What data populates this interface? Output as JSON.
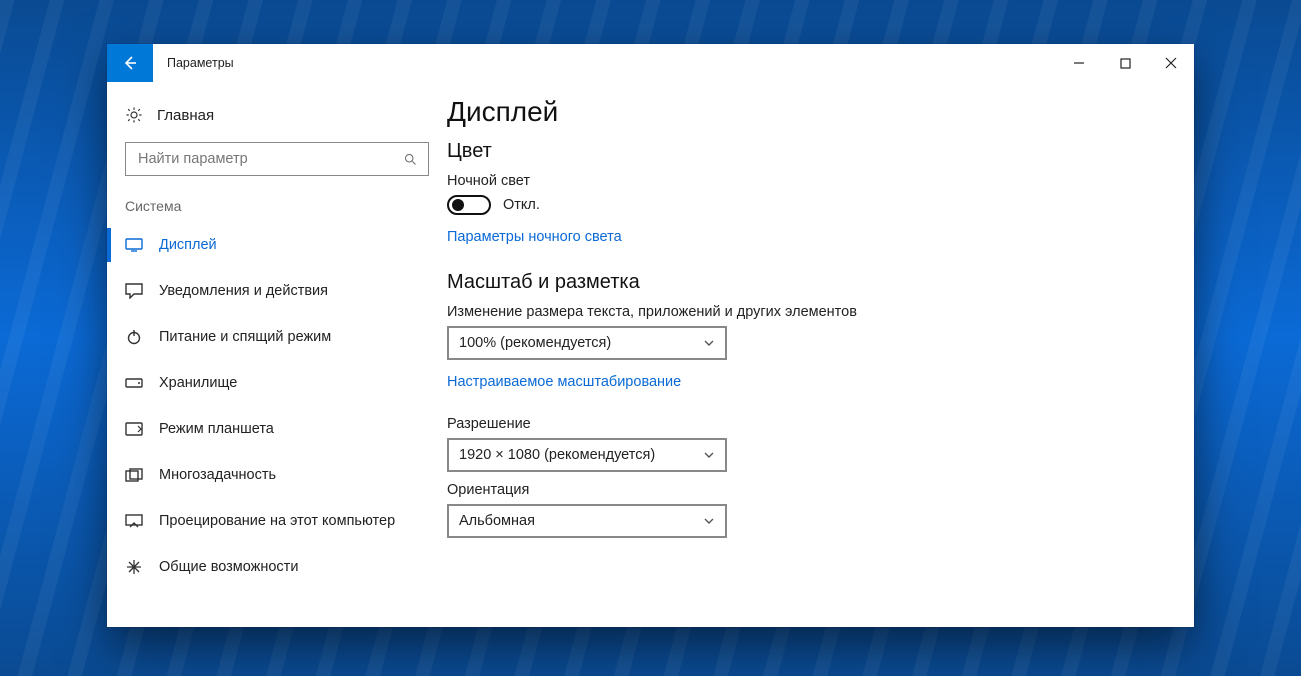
{
  "window": {
    "title": "Параметры"
  },
  "sidebar": {
    "home": "Главная",
    "search_placeholder": "Найти параметр",
    "category": "Система",
    "items": [
      {
        "label": "Дисплей"
      },
      {
        "label": "Уведомления и действия"
      },
      {
        "label": "Питание и спящий режим"
      },
      {
        "label": "Хранилище"
      },
      {
        "label": "Режим планшета"
      },
      {
        "label": "Многозадачность"
      },
      {
        "label": "Проецирование на этот компьютер"
      },
      {
        "label": "Общие возможности"
      }
    ]
  },
  "main": {
    "heading": "Дисплей",
    "color_section": "Цвет",
    "night_light_label": "Ночной свет",
    "night_light_state": "Откл.",
    "night_light_settings_link": "Параметры ночного света",
    "scale_section": "Масштаб и разметка",
    "scale_label": "Изменение размера текста, приложений и других элементов",
    "scale_value": "100% (рекомендуется)",
    "custom_scaling_link": "Настраиваемое масштабирование",
    "resolution_label": "Разрешение",
    "resolution_value": "1920 × 1080 (рекомендуется)",
    "orientation_label": "Ориентация",
    "orientation_value": "Альбомная"
  }
}
